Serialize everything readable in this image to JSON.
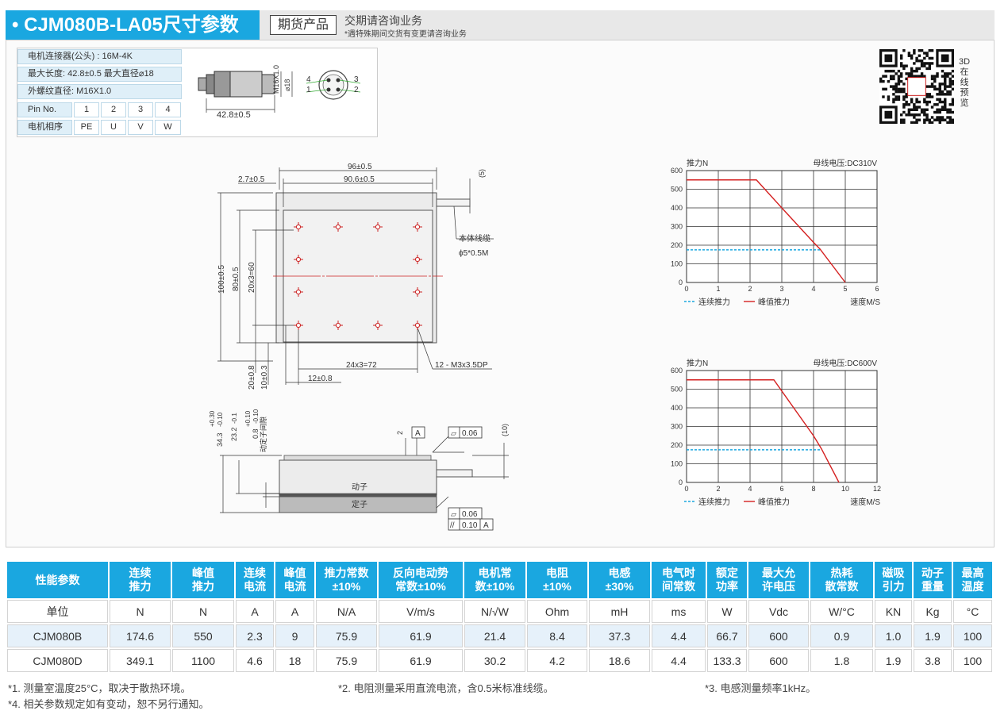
{
  "header": {
    "title": "• CJM080B-LA05尺寸参数",
    "badge": "期货产品",
    "note_main": "交期请咨询业务",
    "note_sub": "*遇特殊期间交货有变更请咨询业务"
  },
  "connector": {
    "type_line": "电机连接器(公头) : 16M-4K",
    "size_line": "最大长度:  42.8±0.5    最大直径⌀18",
    "thread_line": "外螺纹直径:  M16X1.0",
    "pin_label": "Pin No.",
    "pins": [
      "1",
      "2",
      "3",
      "4"
    ],
    "phase_label": "电机相序",
    "phases": [
      "PE",
      "U",
      "V",
      "W"
    ],
    "drawing_thread": "M16X1.0",
    "drawing_dia": "⌀18",
    "drawing_length": "42.8±0.5",
    "pin_marks": [
      "4",
      "3",
      "1",
      "2"
    ]
  },
  "qr": {
    "label": "3D在线预览"
  },
  "top_view": {
    "dim_width": "96±0.5",
    "dim_inner_width": "90.6±0.5",
    "dim_offset": "2.7±0.5",
    "dim_cable_dia": "(5)",
    "dim_height": "100±0.5",
    "dim_inner_height": "80±0.5",
    "dim_hole_pitch_v": "20x3=60",
    "dim_bottom_a": "20±0.8",
    "dim_bottom_b": "10±0.3",
    "dim_hole_pitch_h": "24x3=72",
    "dim_hole_offset": "12±0.8",
    "holes_note": "12 - M3x3.5DP",
    "cable_label": "本体线缆",
    "cable_spec": "ϕ5*0.5M"
  },
  "side_view": {
    "dim_total": "34.3",
    "dim_total_tol_up": "+0.30",
    "dim_total_tol_dn": "-0.10",
    "dim_mover": "23.2",
    "dim_mover_tol": "-0.1",
    "dim_gap": "0.8",
    "dim_gap_tol_up": "+0.10",
    "dim_gap_tol_dn": "-0.10",
    "dim_gap_label": "动定子间隙",
    "dim_small": "2",
    "datum": "A",
    "flatness_1": "0.06",
    "dim_cable_h": "(10)",
    "mover_label": "动子",
    "stator_label": "定子",
    "flatness_2": "0.06",
    "parallel_value": "0.10",
    "parallel_datum": "A"
  },
  "chart_data": [
    {
      "type": "line",
      "ylabel": "推力N",
      "xlabel": "速度M/S",
      "title": "母线电压:DC310V",
      "xlim": [
        0,
        6
      ],
      "ylim": [
        0,
        600
      ],
      "x_ticks": [
        0,
        1,
        2,
        3,
        4,
        5,
        6
      ],
      "y_ticks": [
        0,
        100,
        200,
        300,
        400,
        500,
        600
      ],
      "grid": true,
      "legend": "bottom",
      "series": [
        {
          "name": "连续推力",
          "style": "dashed",
          "color": "#1aa7e0",
          "x": [
            0,
            4.2
          ],
          "y": [
            175,
            175
          ]
        },
        {
          "name": "峰值推力",
          "style": "solid",
          "color": "#d42020",
          "x": [
            0,
            2.2,
            3.0,
            4.0,
            4.2,
            5.0
          ],
          "y": [
            550,
            550,
            400,
            215,
            180,
            0
          ]
        }
      ]
    },
    {
      "type": "line",
      "ylabel": "推力N",
      "xlabel": "速度M/S",
      "title": "母线电压:DC600V",
      "xlim": [
        0,
        12
      ],
      "ylim": [
        0,
        600
      ],
      "x_ticks": [
        0,
        2,
        4,
        6,
        8,
        10,
        12
      ],
      "y_ticks": [
        0,
        100,
        200,
        300,
        400,
        500,
        600
      ],
      "grid": true,
      "legend": "bottom",
      "series": [
        {
          "name": "连续推力",
          "style": "dashed",
          "color": "#1aa7e0",
          "x": [
            0,
            8.5
          ],
          "y": [
            175,
            175
          ]
        },
        {
          "name": "峰值推力",
          "style": "solid",
          "color": "#d42020",
          "x": [
            0,
            5.5,
            8.0,
            8.5,
            9.6
          ],
          "y": [
            550,
            550,
            250,
            180,
            0
          ]
        }
      ]
    }
  ],
  "perf_table": {
    "headers": [
      [
        "性能参数"
      ],
      [
        "连续",
        "推力"
      ],
      [
        "峰值",
        "推力"
      ],
      [
        "连续",
        "电流"
      ],
      [
        "峰值",
        "电流"
      ],
      [
        "推力常数",
        "±10%"
      ],
      [
        "反向电动势",
        "常数±10%"
      ],
      [
        "电机常",
        "数±10%"
      ],
      [
        "电阻",
        "±10%"
      ],
      [
        "电感",
        "±30%"
      ],
      [
        "电气时",
        "间常数"
      ],
      [
        "额定",
        "功率"
      ],
      [
        "最大允",
        "许电压"
      ],
      [
        "热耗",
        "散常数"
      ],
      [
        "磁吸",
        "引力"
      ],
      [
        "动子",
        "重量"
      ],
      [
        "最高",
        "温度"
      ]
    ],
    "rows": [
      [
        "单位",
        "N",
        "N",
        "A",
        "A",
        "N/A",
        "V/m/s",
        "N/√W",
        "Ohm",
        "mH",
        "ms",
        "W",
        "Vdc",
        "W/°C",
        "KN",
        "Kg",
        "°C"
      ],
      [
        "CJM080B",
        "174.6",
        "550",
        "2.3",
        "9",
        "75.9",
        "61.9",
        "21.4",
        "8.4",
        "37.3",
        "4.4",
        "66.7",
        "600",
        "0.9",
        "1.0",
        "1.9",
        "100"
      ],
      [
        "CJM080D",
        "349.1",
        "1100",
        "4.6",
        "18",
        "75.9",
        "61.9",
        "30.2",
        "4.2",
        "18.6",
        "4.4",
        "133.3",
        "600",
        "1.8",
        "1.9",
        "3.8",
        "100"
      ]
    ]
  },
  "footnotes": [
    "*1. 测量室温度25°C，取决于散热环境。",
    "*2. 电阻测量采用直流电流，含0.5米标准线缆。",
    "*3. 电感测量频率1kHz。",
    "*4. 相关参数规定如有变动，恕不另行通知。"
  ]
}
